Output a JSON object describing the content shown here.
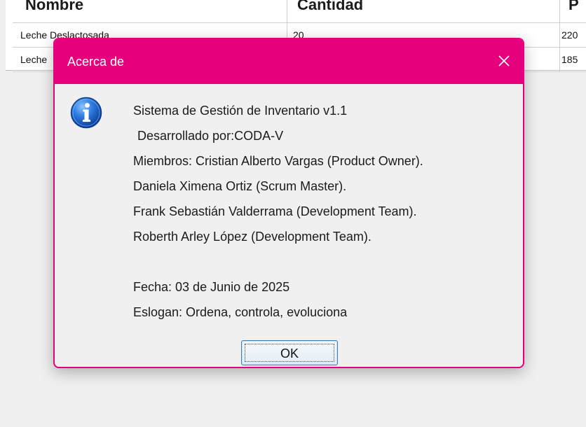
{
  "background_table": {
    "headers": [
      "Nombre",
      "Cantidad",
      "P"
    ],
    "rows": [
      [
        "Leche Deslactosada",
        "20",
        "220"
      ],
      [
        "Leche",
        "",
        "185"
      ]
    ]
  },
  "dialog": {
    "title": "Acerca de",
    "icon": "information-icon",
    "message_lines": [
      "Sistema de Gestión de Inventario v1.1",
      "Desarrollado por:CODA-V",
      "Miembros: Cristian Alberto Vargas (Product Owner).",
      "Daniela Ximena Ortiz (Scrum Master).",
      "Frank Sebastián Valderrama (Development Team).",
      "Roberth Arley López (Development Team)."
    ],
    "footer_lines": [
      "Fecha: 03 de Junio de 2025",
      "Eslogan: Ordena, controla, evoluciona"
    ],
    "ok_label": "OK",
    "accent_color": "#e6007e"
  }
}
